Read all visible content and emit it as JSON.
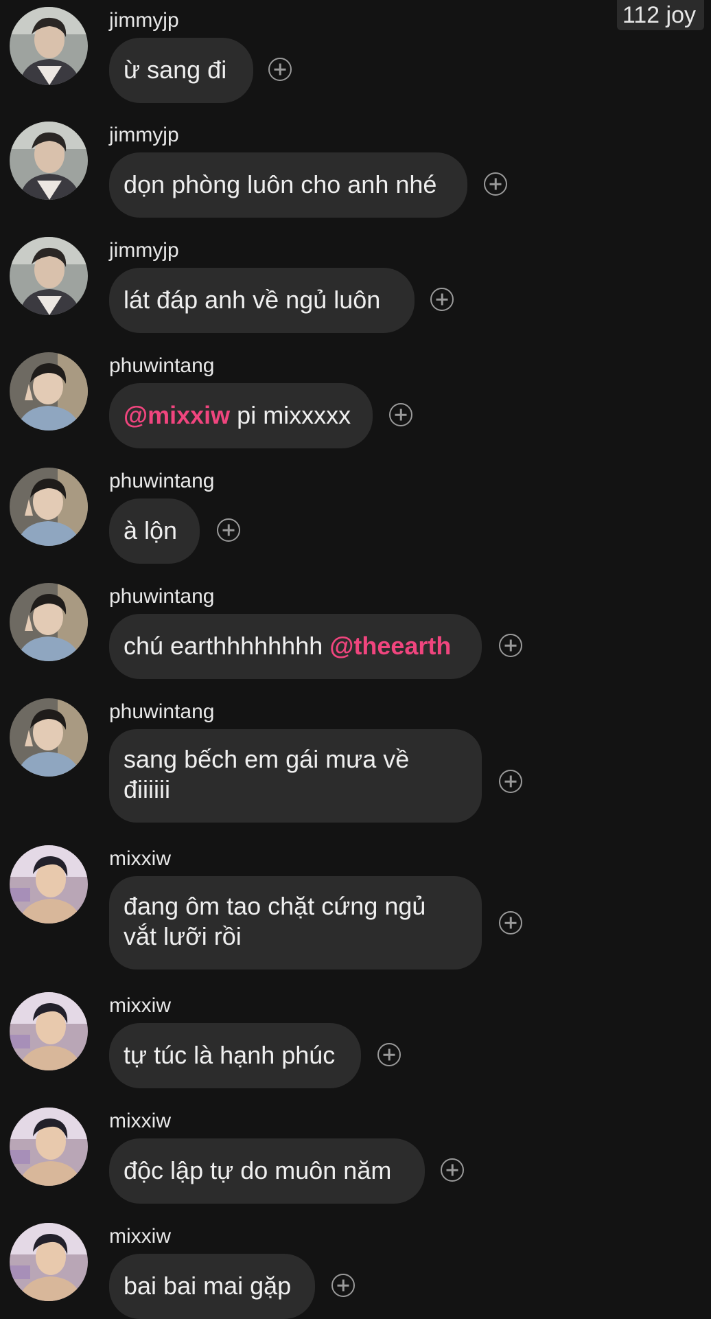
{
  "header": {
    "badge_label": "112 joy"
  },
  "messages": [
    {
      "user": "jimmyjp",
      "avatar": "avatar-jimmyjp",
      "text": "ừ sang đi"
    },
    {
      "user": "jimmyjp",
      "avatar": "avatar-jimmyjp",
      "text": "dọn phòng luôn cho anh nhé"
    },
    {
      "user": "jimmyjp",
      "avatar": "avatar-jimmyjp",
      "text": "lát đáp anh về ngủ luôn"
    },
    {
      "user": "phuwintang",
      "avatar": "avatar-phuwintang",
      "mention_before": "@mixxiw",
      "text": " pi mixxxxx"
    },
    {
      "user": "phuwintang",
      "avatar": "avatar-phuwintang",
      "text": "à lộn"
    },
    {
      "user": "phuwintang",
      "avatar": "avatar-phuwintang",
      "text": "chú earthhhhhhhh ",
      "mention_after": "@theearth"
    },
    {
      "user": "phuwintang",
      "avatar": "avatar-phuwintang",
      "text_line1": "sang bếch em gái mưa về",
      "text_line2": "điiiiii"
    },
    {
      "user": "mixxiw",
      "avatar": "avatar-mixxiw",
      "text_line1": "đang ôm tao chặt cứng ngủ",
      "text_line2": "vắt lưỡi rồi"
    },
    {
      "user": "mixxiw",
      "avatar": "avatar-mixxiw",
      "text": "tự túc là hạnh phúc"
    },
    {
      "user": "mixxiw",
      "avatar": "avatar-mixxiw",
      "text": "độc lập tự do muôn năm"
    },
    {
      "user": "mixxiw",
      "avatar": "avatar-mixxiw",
      "text": "bai bai mai gặp"
    }
  ],
  "icons": {
    "add": "add-reaction-icon"
  },
  "colors": {
    "background": "#131313",
    "bubble": "#2c2c2c",
    "mention": "#f0457e",
    "text": "#efefef"
  }
}
